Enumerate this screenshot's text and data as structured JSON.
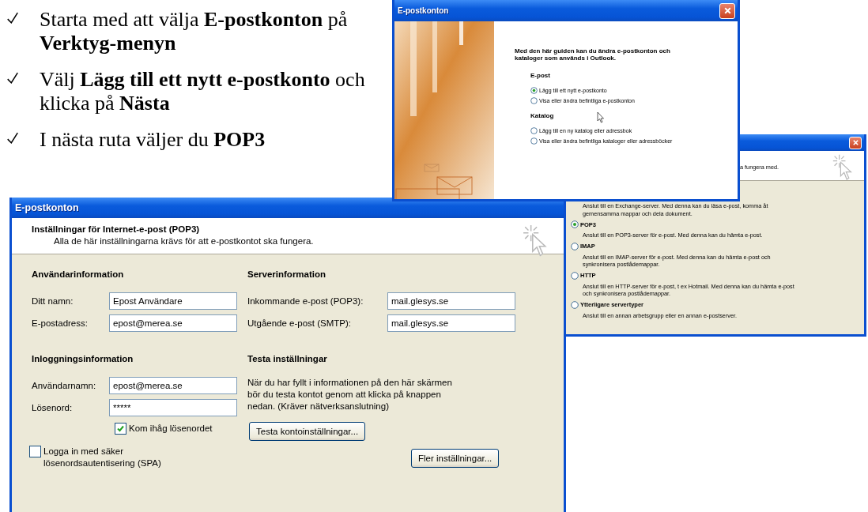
{
  "instructions": [
    {
      "text": "Starta med att välja **E-postkonton** på **Verktyg-menyn**"
    },
    {
      "text": "Välj **Lägg till ett nytt e-postkonto** och klicka på **Nästa**"
    },
    {
      "text": "I nästa ruta väljer du **POP3**"
    }
  ],
  "wizard_window": {
    "title": "E-postkonton",
    "intro": "Med den här guiden kan du ändra e-postkonton och kataloger som används i Outlook.",
    "sections": [
      {
        "heading": "E-post",
        "options": [
          {
            "label": "Lägg till ett nytt e-postkonto",
            "selected": true
          },
          {
            "label": "Visa eller ändra befintliga e-postkonton",
            "selected": false
          }
        ]
      },
      {
        "heading": "Katalog",
        "options": [
          {
            "label": "Lägg till en ny katalog eller adressbok",
            "selected": false
          },
          {
            "label": "Visa eller ändra befintliga kataloger eller adressböcker",
            "selected": false
          }
        ]
      }
    ]
  },
  "server_type_window": {
    "header_text": "a fungera med.",
    "options": [
      {
        "description": "Anslut till en Exchange-server. Med denna kan du läsa e-post, komma åt gemensamma mappar och dela dokument."
      },
      {
        "label": "POP3",
        "selected": true,
        "description": "Anslut till en POP3-server för e-post. Med denna kan du hämta e-post."
      },
      {
        "label": "IMAP",
        "selected": false,
        "description": "Anslut till en IMAP-server för e-post. Med denna kan du hämta e-post och synkronisera postlådemappar."
      },
      {
        "label": "HTTP",
        "selected": false,
        "description": "Anslut till en HTTP-server för e-post, t ex Hotmail. Med denna kan du hämta e-post och synkronisera postlådemappar."
      },
      {
        "label": "Ytterligare servertyper",
        "selected": false,
        "description": "Anslut till en annan arbetsgrupp eller en annan e-postserver."
      }
    ]
  },
  "settings_window": {
    "title": "E-postkonton",
    "header_title": "Inställningar för Internet-e-post (POP3)",
    "header_subtitle": "Alla de här inställningarna krävs för att e-postkontot ska fungera.",
    "user_info": {
      "heading": "Användarinformation",
      "fields": [
        {
          "label": "Ditt namn:",
          "value": "Epost Användare"
        },
        {
          "label": "E-postadress:",
          "value": "epost@merea.se"
        }
      ]
    },
    "server_info": {
      "heading": "Serverinformation",
      "fields": [
        {
          "label": "Inkommande e-post (POP3):",
          "value": "mail.glesys.se"
        },
        {
          "label": "Utgående e-post (SMTP):",
          "value": "mail.glesys.se"
        }
      ]
    },
    "login_info": {
      "heading": "Inloggningsinformation",
      "fields": [
        {
          "label": "Användarnamn:",
          "value": "epost@merea.se"
        },
        {
          "label": "Lösenord:",
          "value": "*****"
        }
      ],
      "remember_password": {
        "label": "Kom ihåg lösenordet",
        "checked": true
      }
    },
    "spa": {
      "label": "Logga in med säker lösenordsautentisering (SPA)",
      "checked": false
    },
    "test": {
      "heading": "Testa inställningar",
      "text": "När du har fyllt i informationen på den här skärmen bör du testa kontot genom att klicka på knappen nedan. (Kräver nätverksanslutning)",
      "button": "Testa kontoinställningar..."
    },
    "more_button": "Fler inställningar..."
  }
}
